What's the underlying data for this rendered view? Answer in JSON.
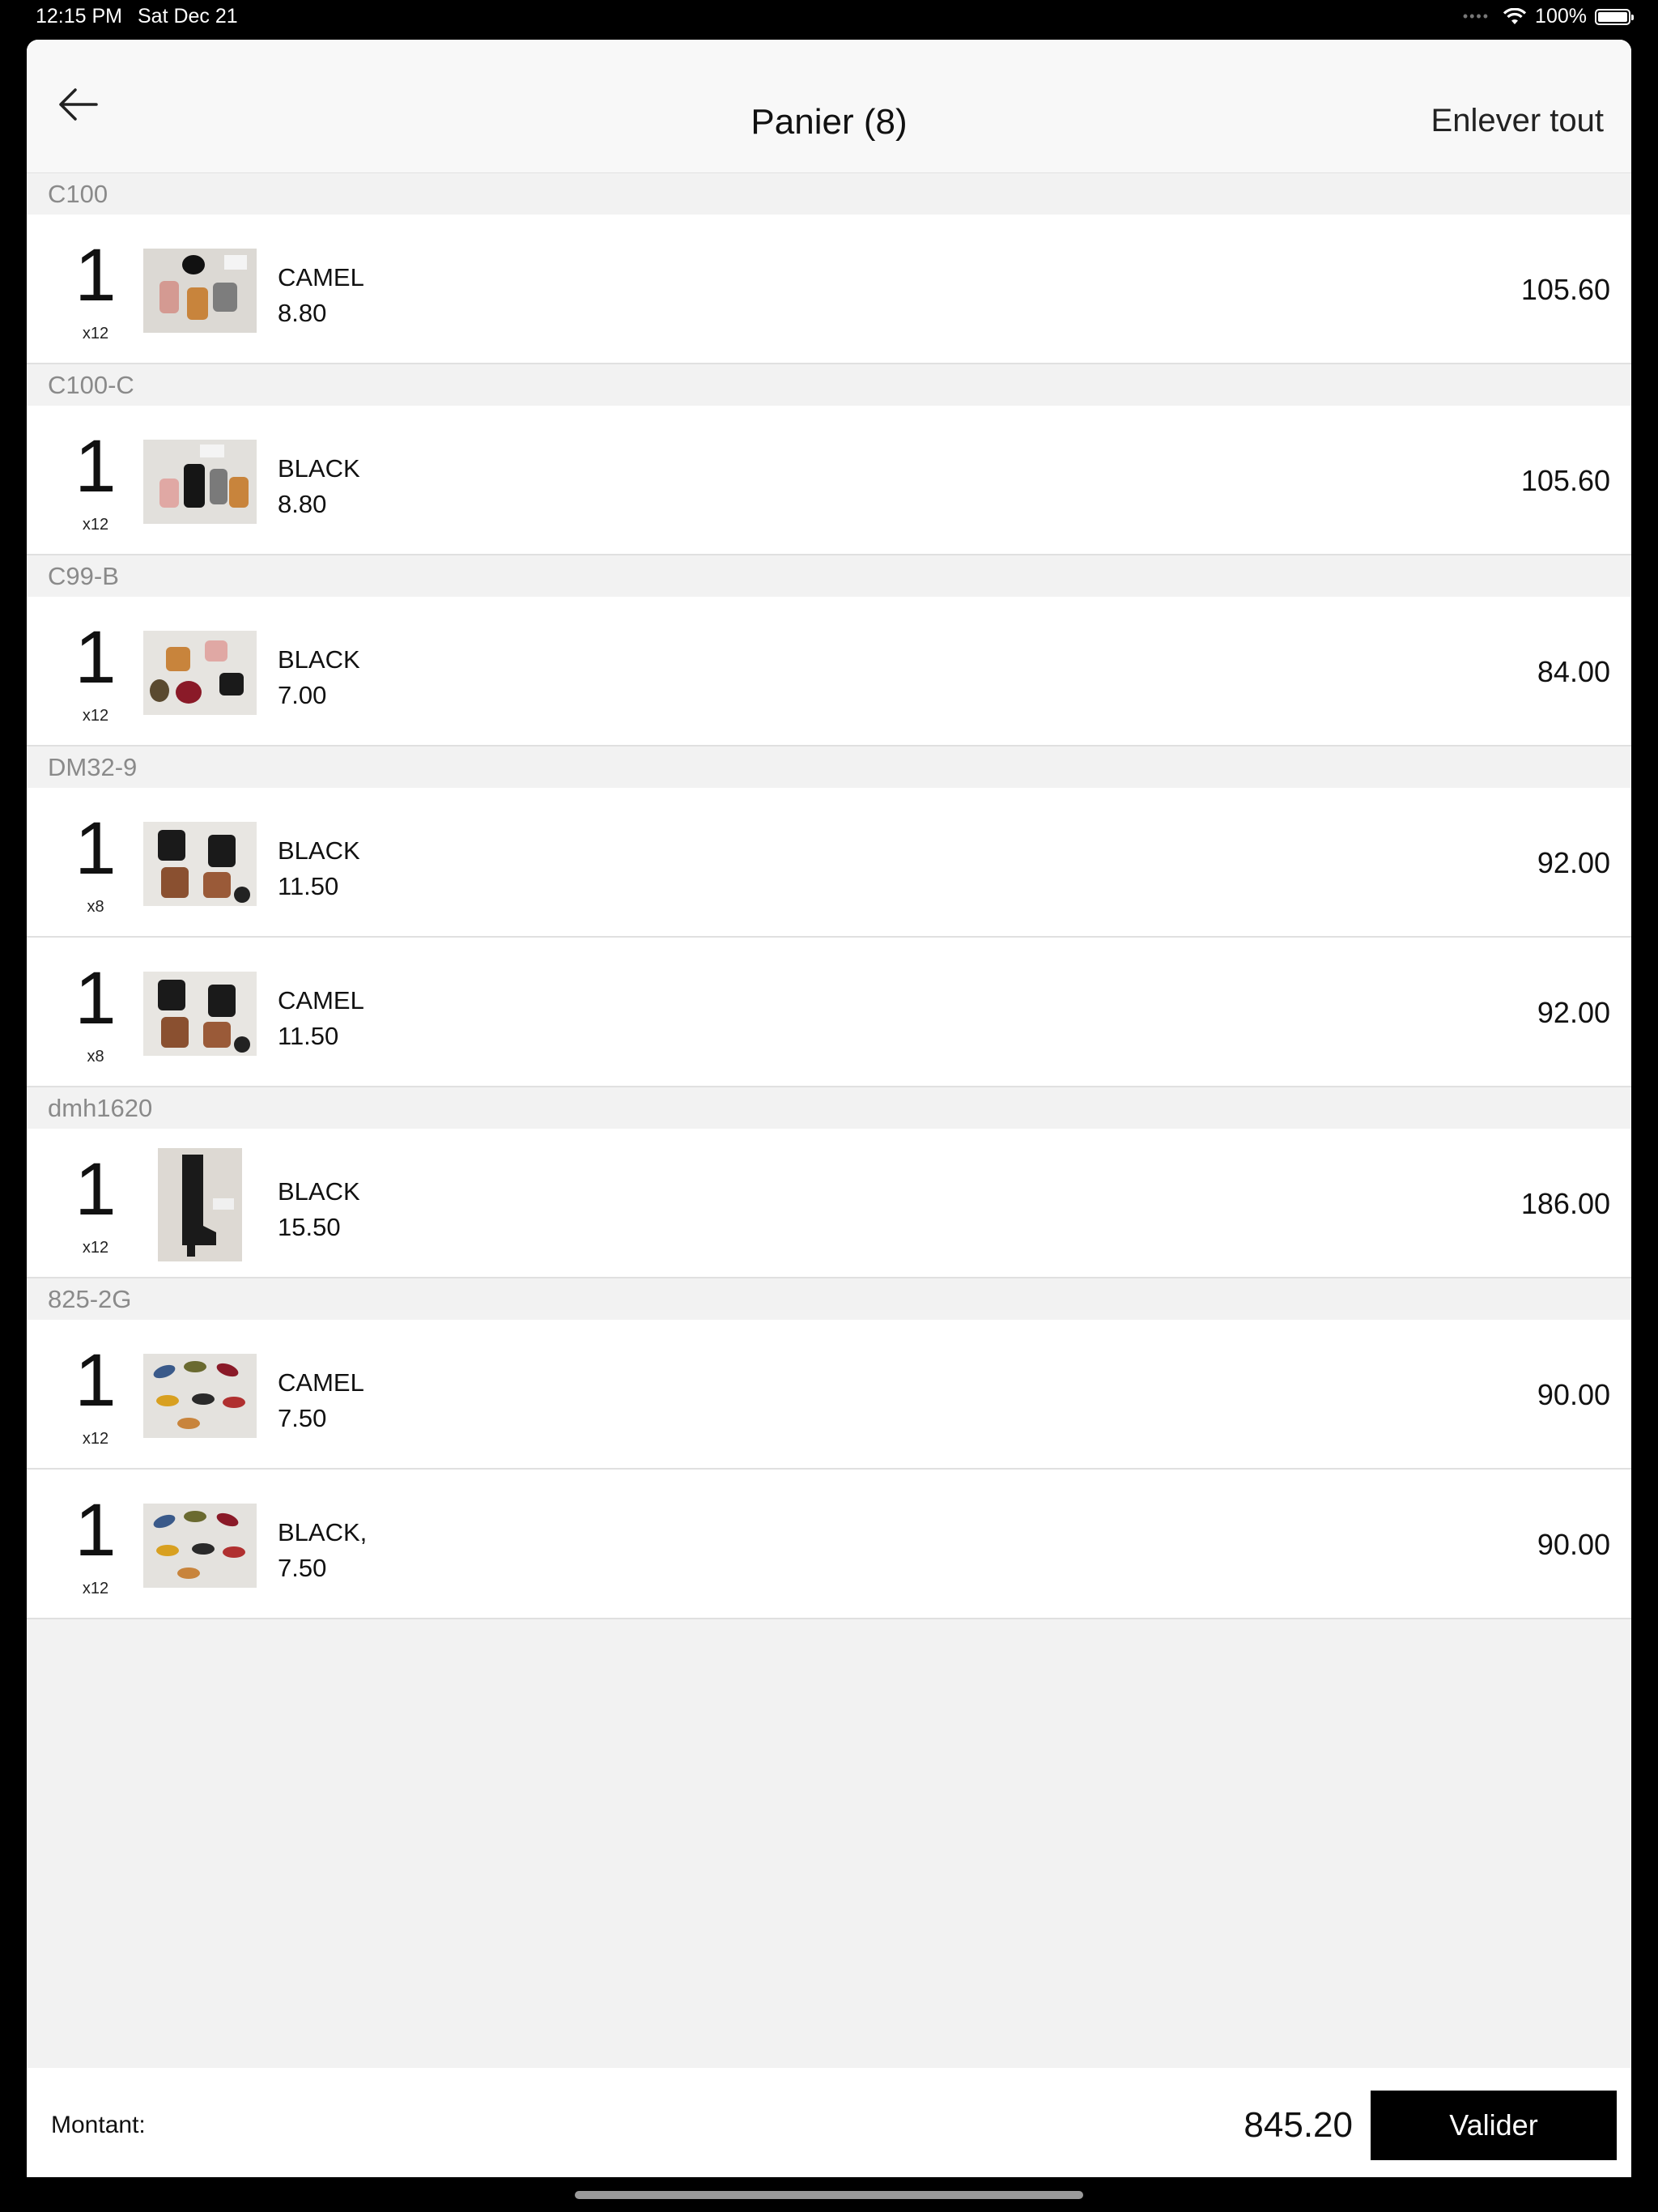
{
  "status_bar": {
    "time": "12:15 PM",
    "date": "Sat Dec 21",
    "battery": "100%"
  },
  "nav": {
    "title": "Panier (8)",
    "remove_all": "Enlever tout",
    "back_icon": "arrow-left-icon"
  },
  "groups": [
    {
      "name": "C100",
      "items": [
        {
          "qty": "1",
          "mult": "x12",
          "color": "CAMEL",
          "price": "8.80",
          "total": "105.60"
        }
      ]
    },
    {
      "name": "C100-C",
      "items": [
        {
          "qty": "1",
          "mult": "x12",
          "color": "BLACK",
          "price": "8.80",
          "total": "105.60"
        }
      ]
    },
    {
      "name": "C99-B",
      "items": [
        {
          "qty": "1",
          "mult": "x12",
          "color": "BLACK",
          "price": "7.00",
          "total": "84.00"
        }
      ]
    },
    {
      "name": "DM32-9",
      "items": [
        {
          "qty": "1",
          "mult": "x8",
          "color": "BLACK",
          "price": "11.50",
          "total": "92.00"
        },
        {
          "qty": "1",
          "mult": "x8",
          "color": "CAMEL",
          "price": "11.50",
          "total": "92.00"
        }
      ]
    },
    {
      "name": "dmh1620",
      "items": [
        {
          "qty": "1",
          "mult": "x12",
          "color": "BLACK",
          "price": "15.50",
          "total": "186.00"
        }
      ]
    },
    {
      "name": "825-2G",
      "items": [
        {
          "qty": "1",
          "mult": "x12",
          "color": "CAMEL",
          "price": "7.50",
          "total": "90.00"
        },
        {
          "qty": "1",
          "mult": "x12",
          "color": "BLACK,",
          "price": "7.50",
          "total": "90.00"
        }
      ]
    }
  ],
  "footer": {
    "amount_label": "Montant:",
    "amount_value": "845.20",
    "validate_label": "Valider"
  }
}
